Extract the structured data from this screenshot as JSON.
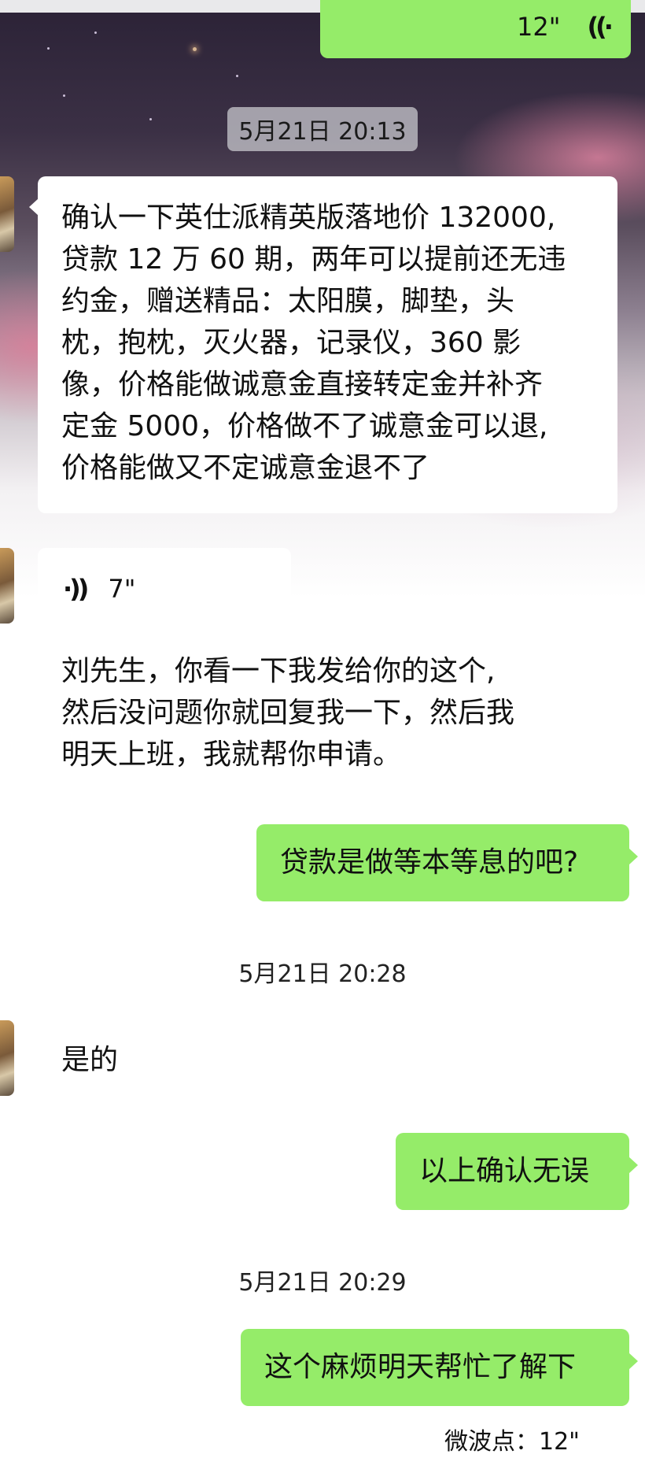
{
  "messages": {
    "top_voice": {
      "duration": "12\""
    },
    "ts1": "5月21日 20:13",
    "msg1": [
      "确认一下英仕派精英版落地价 132000,",
      "贷款 12 万 60 期，两年可以提前还无违",
      "约金，赠送精品：太阳膜，脚垫，头",
      "枕，抱枕，灭火器，记录仪，360 影",
      "像，价格能做诚意金直接转定金并补齐",
      "定金 5000，价格做不了诚意金可以退,",
      "价格能做又不定诚意金退不了"
    ],
    "voice2": {
      "duration": "7\""
    },
    "transcript2": [
      "刘先生，你看一下我发给你的这个,",
      "然后没问题你就回复我一下，然后我",
      "明天上班，我就帮你申请。"
    ],
    "msg3": "贷款是做等本等息的吧?",
    "ts2": "5月21日 20:28",
    "msg4": "是的",
    "msg5": "以上确认无误",
    "ts3": "5月21日 20:29",
    "msg6": "这个麻烦明天帮忙了解下",
    "bottom_partial": "微波点：12\""
  },
  "colors": {
    "sent_bubble": "#95ec69",
    "received_bubble": "#ffffff"
  },
  "icons": [
    "voice-wave-icon",
    "avatar"
  ]
}
